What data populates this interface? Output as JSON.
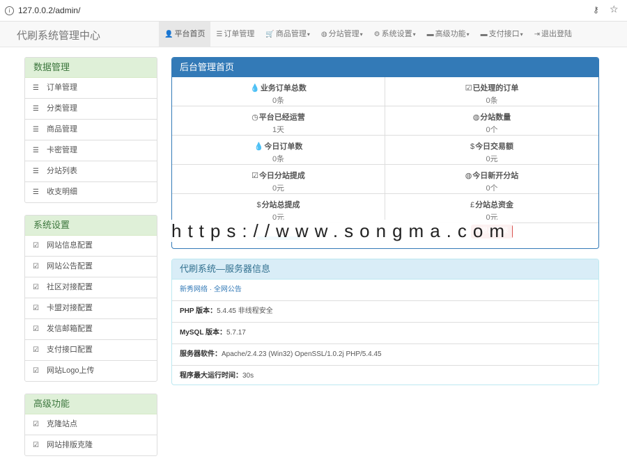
{
  "browser": {
    "url": "127.0.0.2/admin/",
    "info_icon": "info-icon",
    "key_icon": "key-icon",
    "star_icon": "star-icon"
  },
  "navbar": {
    "brand": "代刷系统管理中心",
    "items": [
      {
        "icon": "user-icon",
        "glyph": "👤",
        "label": "平台首页",
        "active": true,
        "dropdown": false
      },
      {
        "icon": "list-icon",
        "glyph": "☰",
        "label": "订单管理",
        "active": false,
        "dropdown": false
      },
      {
        "icon": "cart-icon",
        "glyph": "🛒",
        "label": "商品管理",
        "active": false,
        "dropdown": true
      },
      {
        "icon": "globe-icon",
        "glyph": "◍",
        "label": "分站管理",
        "active": false,
        "dropdown": true
      },
      {
        "icon": "cog-icon",
        "glyph": "⚙",
        "label": "系统设置",
        "active": false,
        "dropdown": true
      },
      {
        "icon": "briefcase-icon",
        "glyph": "▬",
        "label": "高级功能",
        "active": false,
        "dropdown": true
      },
      {
        "icon": "briefcase-icon",
        "glyph": "▬",
        "label": "支付接口",
        "active": false,
        "dropdown": true
      },
      {
        "icon": "logout-icon",
        "glyph": "⇥",
        "label": "退出登陆",
        "active": false,
        "dropdown": false
      }
    ]
  },
  "sidebar": {
    "sections": [
      {
        "title": "数据管理",
        "icon_glyph": "☰",
        "items": [
          "订单管理",
          "分类管理",
          "商品管理",
          "卡密管理",
          "分站列表",
          "收支明细"
        ]
      },
      {
        "title": "系统设置",
        "icon_glyph": "☑",
        "items": [
          "网站信息配置",
          "网站公告配置",
          "社区对接配置",
          "卡盟对接配置",
          "发信邮箱配置",
          "支付接口配置",
          "网站Logo上传"
        ]
      },
      {
        "title": "高级功能",
        "icon_glyph": "☑",
        "items": [
          "克隆站点",
          "网站排版克隆"
        ]
      }
    ]
  },
  "dashboard": {
    "title": "后台管理首页",
    "stats": [
      {
        "icon": "drop-icon",
        "glyph": "💧",
        "label": "业务订单总数",
        "value": "0条"
      },
      {
        "icon": "check-icon",
        "glyph": "☑",
        "label": "已处理的订单",
        "value": "0条"
      },
      {
        "icon": "clock-icon",
        "glyph": "◷",
        "label": "平台已经运营",
        "value": "1天"
      },
      {
        "icon": "globe-icon",
        "glyph": "◍",
        "label": "分站数量",
        "value": "0个"
      },
      {
        "icon": "drop-icon",
        "glyph": "💧",
        "label": "今日订单数",
        "value": "0条"
      },
      {
        "icon": "dollar-icon",
        "glyph": "$",
        "label": "今日交易额",
        "value": "0元"
      },
      {
        "icon": "check-icon",
        "glyph": "☑",
        "label": "今日分站提成",
        "value": "0元"
      },
      {
        "icon": "globe-icon",
        "glyph": "◍",
        "label": "今日新开分站",
        "value": "0个"
      },
      {
        "icon": "dollar-icon",
        "glyph": "$",
        "label": "分站总提成",
        "value": "0元"
      },
      {
        "icon": "pound-icon",
        "glyph": "£",
        "label": "分站总资金",
        "value": "0元"
      }
    ],
    "logout_button": "退出登录"
  },
  "watermark": "https://www.songma.com",
  "server_info": {
    "title": "代刷系统—服务器信息",
    "links": "新秀网络 · 全网公告",
    "rows": [
      {
        "label": "PHP 版本：",
        "value": "5.4.45 非线程安全"
      },
      {
        "label": "MySQL 版本：",
        "value": "5.7.17"
      },
      {
        "label": "服务器软件：",
        "value": "Apache/2.4.23 (Win32) OpenSSL/1.0.2j PHP/5.4.45"
      },
      {
        "label": "程序最大运行时间：",
        "value": "30s"
      }
    ]
  },
  "colors": {
    "primary": "#337ab7",
    "success_bg": "#dff0d8",
    "success_text": "#3c763d",
    "info_bg": "#d9edf7",
    "info_text": "#31708f",
    "danger": "#d9534f"
  }
}
